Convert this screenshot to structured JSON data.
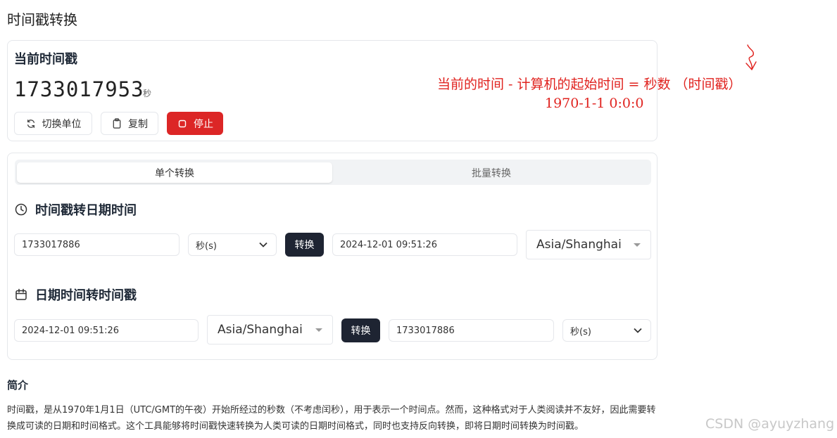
{
  "page": {
    "title": "时间戳转换"
  },
  "current": {
    "title": "当前时间戳",
    "timestamp": "1733017953",
    "unit": "秒",
    "buttons": {
      "switch_unit": "切换单位",
      "copy": "复制",
      "stop": "停止"
    }
  },
  "tabs": {
    "single": "单个转换",
    "batch": "批量转换"
  },
  "ts_to_date": {
    "title": "时间戳转日期时间",
    "input_value": "1733017886",
    "unit_select": "秒(s)",
    "convert_label": "转换",
    "result_value": "2024-12-01 09:51:26",
    "timezone": "Asia/Shanghai"
  },
  "date_to_ts": {
    "title": "日期时间转时间戳",
    "input_value": "2024-12-01 09:51:26",
    "timezone": "Asia/Shanghai",
    "convert_label": "转换",
    "result_value": "1733017886",
    "unit_select": "秒(s)"
  },
  "intro": {
    "title": "简介",
    "text": "时间戳，是从1970年1月1日（UTC/GMT的午夜）开始所经过的秒数（不考虑闰秒），用于表示一个时间点。然而，这种格式对于人类阅读并不友好，因此需要转换成可读的日期和时间格式。这个工具能够将时间戳快速转换为人类可读的日期时间格式，同时也支持反向转换，即将日期时间转换为时间戳。"
  },
  "annotation": {
    "line1": "当前的时间 - 计算机的起始时间  = 秒数 （时间戳）",
    "line2": "1970-1-1 0:0:0"
  },
  "watermark": "CSDN @ayuyzhang",
  "colors": {
    "accent_red": "#dc2626",
    "dark_button": "#1e2432",
    "annotation_red": "#e0231f"
  },
  "icons": {
    "switch_unit": "refresh-icon",
    "copy": "clipboard-icon",
    "stop": "stop-icon",
    "ts_section": "clock-icon",
    "date_section": "calendar-icon",
    "select": "chevron-down-icon"
  }
}
